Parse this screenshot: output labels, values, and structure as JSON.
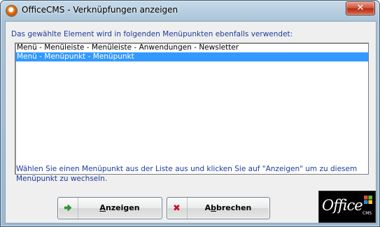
{
  "window": {
    "title": "OfficeCMS - Verknüpfungen anzeigen"
  },
  "close": {
    "label": "✕"
  },
  "main": {
    "description": "Das gewählte Element wird in folgenden Menüpunkten ebenfalls verwendet:",
    "items": [
      {
        "label": "Menü - Menüleiste - Menüleiste - Anwendungen - Newsletter",
        "selected": false
      },
      {
        "label": "Menü - Menüpunkt - Menüpunkt",
        "selected": true
      }
    ],
    "hint": "Wählen Sie einen Menüpunkt aus der Liste aus und klicken Sie auf \"Anzeigen\" um zu diesem Menüpunkt zu wechseln."
  },
  "buttons": {
    "show_label": "Anzeigen",
    "show_accesskey": "A",
    "cancel_label": "Abbrechen",
    "cancel_accesskey": "b"
  },
  "logo": {
    "text": "Office",
    "sub": "CMS"
  },
  "colors": {
    "selection": "#3399ff",
    "text_blue": "#1c3c9c",
    "close_red": "#cf4c33"
  },
  "icons": {
    "app": "app-icon",
    "show": "green-arrow-icon",
    "cancel": "red-x-icon"
  }
}
